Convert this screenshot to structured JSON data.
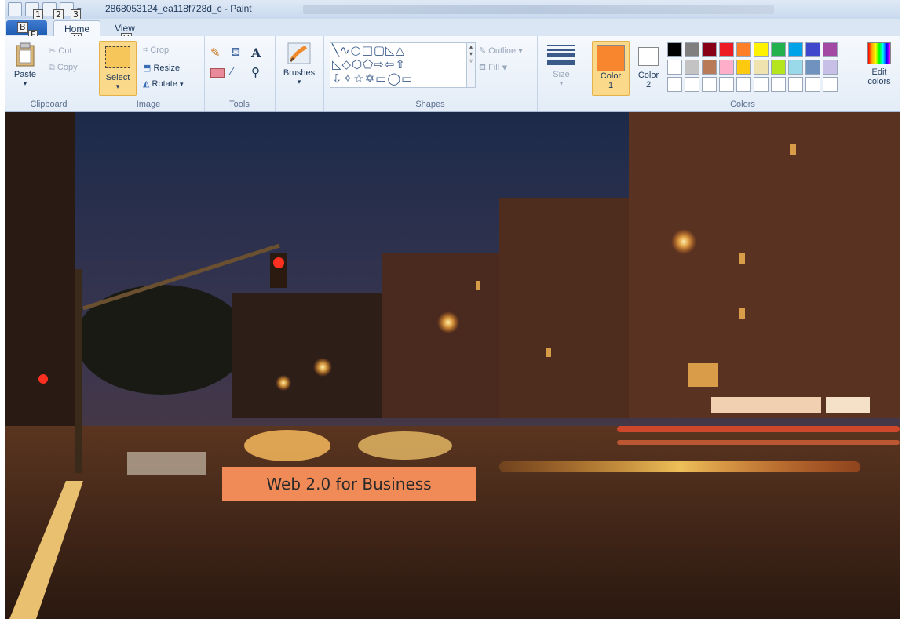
{
  "window": {
    "title": "2868053124_ea118f728d_c - Paint"
  },
  "keytips": {
    "f": "F",
    "b": "B",
    "one": "1",
    "two": "2",
    "three": "3",
    "h": "H",
    "v": "V"
  },
  "tabs": [
    {
      "label": "Home"
    },
    {
      "label": "View"
    }
  ],
  "ribbon": {
    "clipboard": {
      "label": "Clipboard",
      "paste": "Paste",
      "cut": "Cut",
      "copy": "Copy"
    },
    "image": {
      "label": "Image",
      "select": "Select",
      "crop": "Crop",
      "resize": "Resize",
      "rotate": "Rotate"
    },
    "tools": {
      "label": "Tools"
    },
    "brushes": {
      "label": "Brushes"
    },
    "shapes": {
      "label": "Shapes",
      "outline": "Outline",
      "fill": "Fill"
    },
    "size": {
      "label": "Size"
    },
    "colors": {
      "label": "Colors",
      "color1": "Color",
      "color1_num": "1",
      "color2": "Color",
      "color2_num": "2",
      "edit": "Edit",
      "edit2": "colors",
      "color1_value": "#f7862f",
      "color2_value": "#ffffff",
      "palette_row1": [
        "#000000",
        "#7f7f7f",
        "#880015",
        "#ed1c24",
        "#ff7f27",
        "#fff200",
        "#22b14c",
        "#00a2e8",
        "#3f48cc",
        "#a349a4"
      ],
      "palette_row2": [
        "#ffffff",
        "#c3c3c3",
        "#b97a57",
        "#ffaec9",
        "#ffc90e",
        "#efe4b0",
        "#b5e61d",
        "#99d9ea",
        "#7092be",
        "#c8bfe7"
      ]
    }
  },
  "canvas": {
    "overlay_text": "Web 2.0 for Business"
  }
}
